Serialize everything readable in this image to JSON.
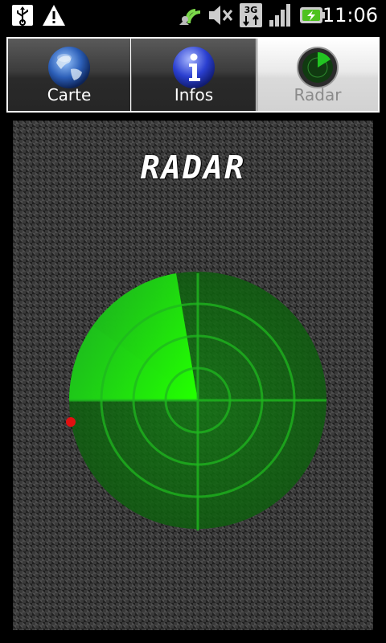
{
  "status_bar": {
    "time": "11:06",
    "icons": [
      "usb-icon",
      "warning-icon",
      "wifi-icon",
      "mute-icon",
      "3g-icon",
      "signal-icon",
      "battery-charging-icon"
    ]
  },
  "tabs": [
    {
      "label": "Carte",
      "icon": "globe-icon",
      "selected": false
    },
    {
      "label": "Infos",
      "icon": "info-icon",
      "selected": false
    },
    {
      "label": "Radar",
      "icon": "radar-icon",
      "selected": true
    }
  ],
  "radar": {
    "title": "RADAR",
    "colors": {
      "sweep": "#22ff00",
      "disc": "#0e5a0e",
      "grid": "#22cc22",
      "blip": "#e01010"
    }
  }
}
